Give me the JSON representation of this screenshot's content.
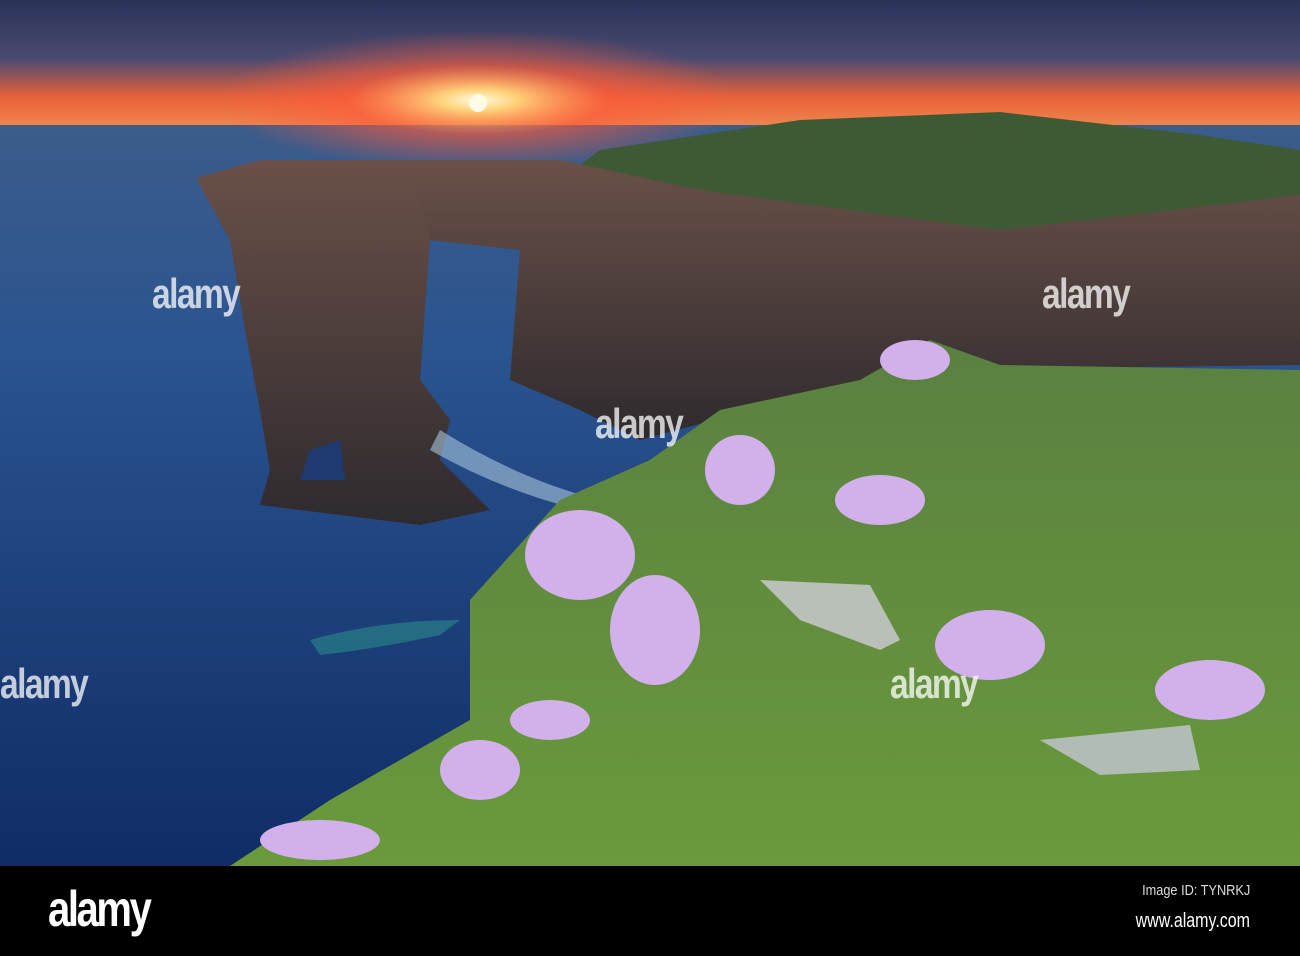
{
  "photo": {
    "subject": "sea stack and cliffs at sunset with pink sea thrift flowers",
    "watermark": "alamy",
    "colors": {
      "sky_top": "#2d3558",
      "sun_glow": "#ff6a3a",
      "sea": "#1d3d78",
      "grass": "#5f8a3a",
      "flowers": "#c8a0e8"
    }
  },
  "footer": {
    "logo": "alamy",
    "image_id": "Image ID: TYNRKJ",
    "website": "www.alamy.com"
  }
}
